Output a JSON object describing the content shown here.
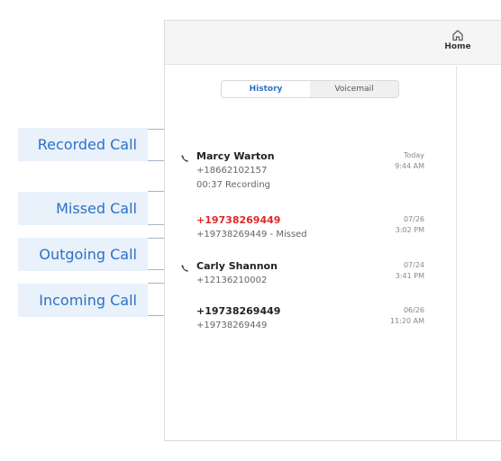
{
  "annotations": {
    "recorded": "Recorded Call",
    "missed": "Missed Call",
    "outgoing": "Outgoing Call",
    "incoming": "Incoming Call"
  },
  "nav": {
    "home_label": "Home",
    "home_icon": "home-icon"
  },
  "tabs": [
    {
      "label": "History",
      "active": true
    },
    {
      "label": "Voicemail",
      "active": false
    }
  ],
  "calls": [
    {
      "name": "Marcy Warton",
      "number": "+18662102157",
      "detail": "00:37 Recording",
      "date": "Today",
      "time": "9:44 AM",
      "icon": "recorded-call-icon"
    },
    {
      "name": "+19738269449",
      "number": "+19738269449 - Missed",
      "date": "07/26",
      "time": "3:02 PM",
      "missed": true
    },
    {
      "name": "Carly Shannon",
      "number": "+12136210002",
      "date": "07/24",
      "time": "3:41 PM",
      "icon": "outgoing-call-icon"
    },
    {
      "name": "+19738269449",
      "number": "+19738269449",
      "date": "06/26",
      "time": "11:20 AM"
    }
  ],
  "colors": {
    "accent": "#2b71c6",
    "label_bg": "#e9f1fb",
    "missed": "#e02828"
  }
}
